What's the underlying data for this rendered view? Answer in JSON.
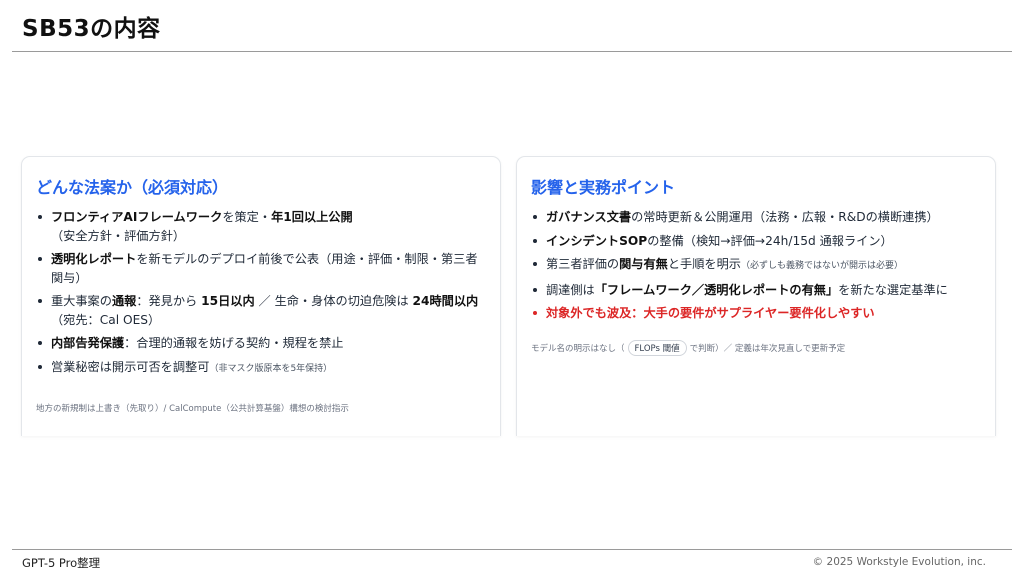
{
  "page": {
    "title": "SB53の内容"
  },
  "left_card": {
    "title": "どんな法案か（必須対応）",
    "items": [
      {
        "p1b": "フロンティアAIフレームワーク",
        "p2": "を策定・",
        "p3b": "年1回以上公開",
        "p4": "（安全方針・評価方針）"
      },
      {
        "p1b": "透明化レポート",
        "p2": "を新モデルのデプロイ前後で公表（用途・評価・制限・第三者関与）"
      },
      {
        "p1": "重大事案の",
        "p2b": "通報",
        "p3": "：発見から ",
        "p4b": "15日以内",
        "p5": " ／ 生命・身体の切迫危険は ",
        "p6b": "24時間以内",
        "p7": "（宛先：Cal OES）"
      },
      {
        "p1b": "内部告発保護",
        "p2": "：合理的通報を妨げる契約・規程を禁止"
      },
      {
        "p1": "営業秘密は開示可否を調整可",
        "p2s": "（非マスク版原本を5年保持）"
      }
    ],
    "note": "地方の新規制は上書き（先取り）/ CalCompute（公共計算基盤）構想の検討指示"
  },
  "right_card": {
    "title": "影響と実務ポイント",
    "items": [
      {
        "p1b": "ガバナンス文書",
        "p2": "の常時更新＆公開運用（法務・広報・R&Dの横断連携）"
      },
      {
        "p1b": "インシデントSOP",
        "p2": "の整備（検知→評価→24h/15d 通報ライン）"
      },
      {
        "p1": "第三者評価の",
        "p2b": "関与有無",
        "p3": "と手順を明示",
        "p4s": "（必ずしも義務ではないが開示は必要）"
      },
      {
        "p1": "調達側は",
        "p2b": "「フレームワーク／透明化レポートの有無」",
        "p3": "を新たな選定基準に"
      },
      {
        "p1": "対象外でも波及：大手の要件がサプライヤー要件化しやすい"
      }
    ],
    "note_before": "モデル名の明示はなし（",
    "note_pill": "FLOPs 閾値",
    "note_after": "で判断）／ 定義は年次見直しで更新予定"
  },
  "footer": {
    "left": "GPT-5 Pro整理",
    "right": "© 2025 Workstyle Evolution, inc."
  }
}
